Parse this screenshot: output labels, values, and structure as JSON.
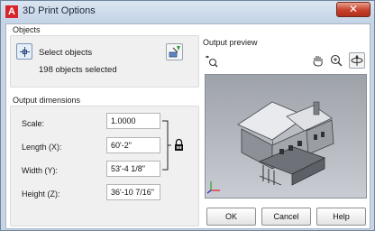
{
  "window": {
    "title": "3D Print Options",
    "app_icon": "A",
    "close_glyph": "✕"
  },
  "objects": {
    "label": "Objects",
    "select_label": "Select objects",
    "count_text": "198 objects selected"
  },
  "dimensions": {
    "label": "Output dimensions",
    "fields": [
      {
        "label": "Scale:",
        "value": "1.0000"
      },
      {
        "label": "Length (X):",
        "value": "60'-2\""
      },
      {
        "label": "Width (Y):",
        "value": "53'-4 1/8\""
      },
      {
        "label": "Height (Z):",
        "value": "36'-10 7/16\""
      }
    ]
  },
  "preview": {
    "label": "Output preview"
  },
  "buttons": {
    "ok": "OK",
    "cancel": "Cancel",
    "help": "Help"
  },
  "colors": {
    "title_accent": "#d7262b",
    "close_button": "#c7402a",
    "preview_background": "#b4b8be"
  },
  "icons": {
    "select_objects": "select-objects-icon",
    "quick_select": "quick-select-icon",
    "lock": "lock-icon",
    "zoom_extents": "zoom-extents-icon",
    "pan": "pan-icon",
    "zoom": "zoom-icon",
    "orbit": "orbit-icon"
  }
}
